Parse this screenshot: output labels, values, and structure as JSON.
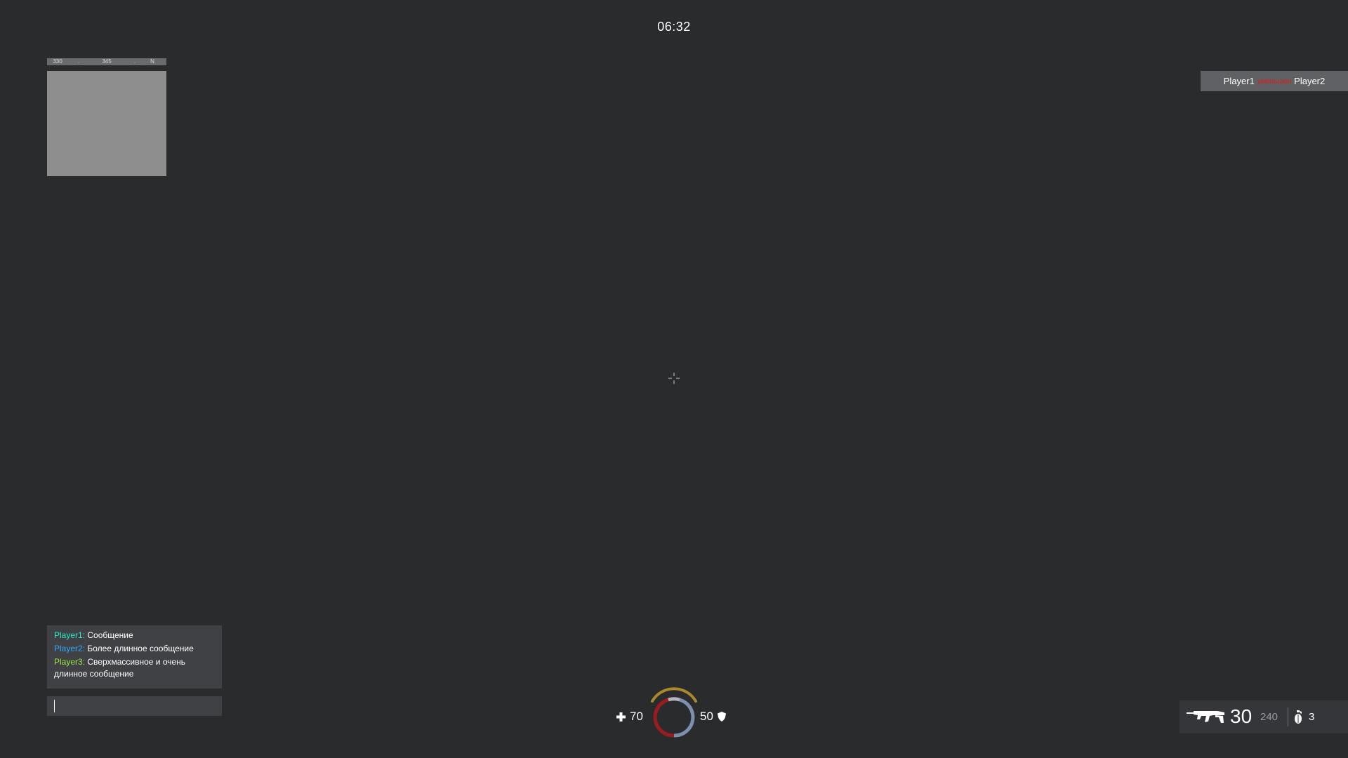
{
  "hud": {
    "timer": "06:32"
  },
  "compass": {
    "labels": [
      "330",
      ".",
      "345",
      ".",
      "N"
    ]
  },
  "killfeed": {
    "killer": "Player1",
    "weapon": "уменьшен",
    "victim": "Player2"
  },
  "chat": {
    "messages": [
      {
        "name": "Player1:",
        "text": "Сообщение",
        "name_color": "#2ee6c8"
      },
      {
        "name": "Player2:",
        "text": "Более длинное сообщение",
        "name_color": "#35a8f5"
      },
      {
        "name": "Player3:",
        "text": "Сверхмассивное и очень длинное сообщение",
        "name_color": "#9ee34a"
      }
    ],
    "input_value": ""
  },
  "vitals": {
    "health": "70",
    "armor": "50",
    "health_icon": "plus-icon",
    "armor_icon": "shield-icon",
    "colors": {
      "health_arc": "#9b1c1f",
      "armor_arc": "#7d8fae",
      "top_arc": "#a88a2c"
    }
  },
  "ammo": {
    "clip": "30",
    "reserve": "240",
    "grenades": "3",
    "weapon_icon": "rifle-icon",
    "grenade_icon": "grenade-icon"
  }
}
